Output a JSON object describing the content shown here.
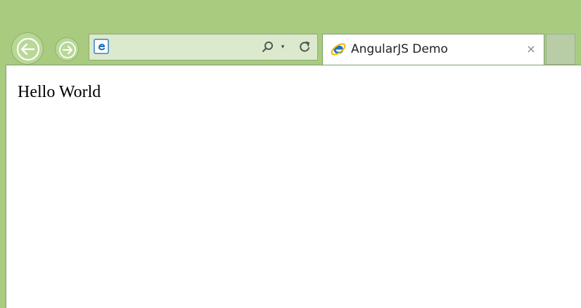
{
  "browser": {
    "navigation": {
      "back_icon": "back-arrow-icon",
      "forward_icon": "forward-arrow-icon"
    },
    "address_bar": {
      "site_icon": "internet-explorer-icon",
      "search_icon": "search-icon",
      "dropdown_glyph": "▾",
      "refresh_icon": "refresh-icon"
    },
    "tabs": [
      {
        "title": "AngularJS Demo",
        "icon": "internet-explorer-icon",
        "close_glyph": "×",
        "active": true
      }
    ]
  },
  "page": {
    "text": "Hello World"
  },
  "colors": {
    "chrome": "#a8cb80",
    "address_bar": "#dbe9cc",
    "content": "#ffffff"
  }
}
